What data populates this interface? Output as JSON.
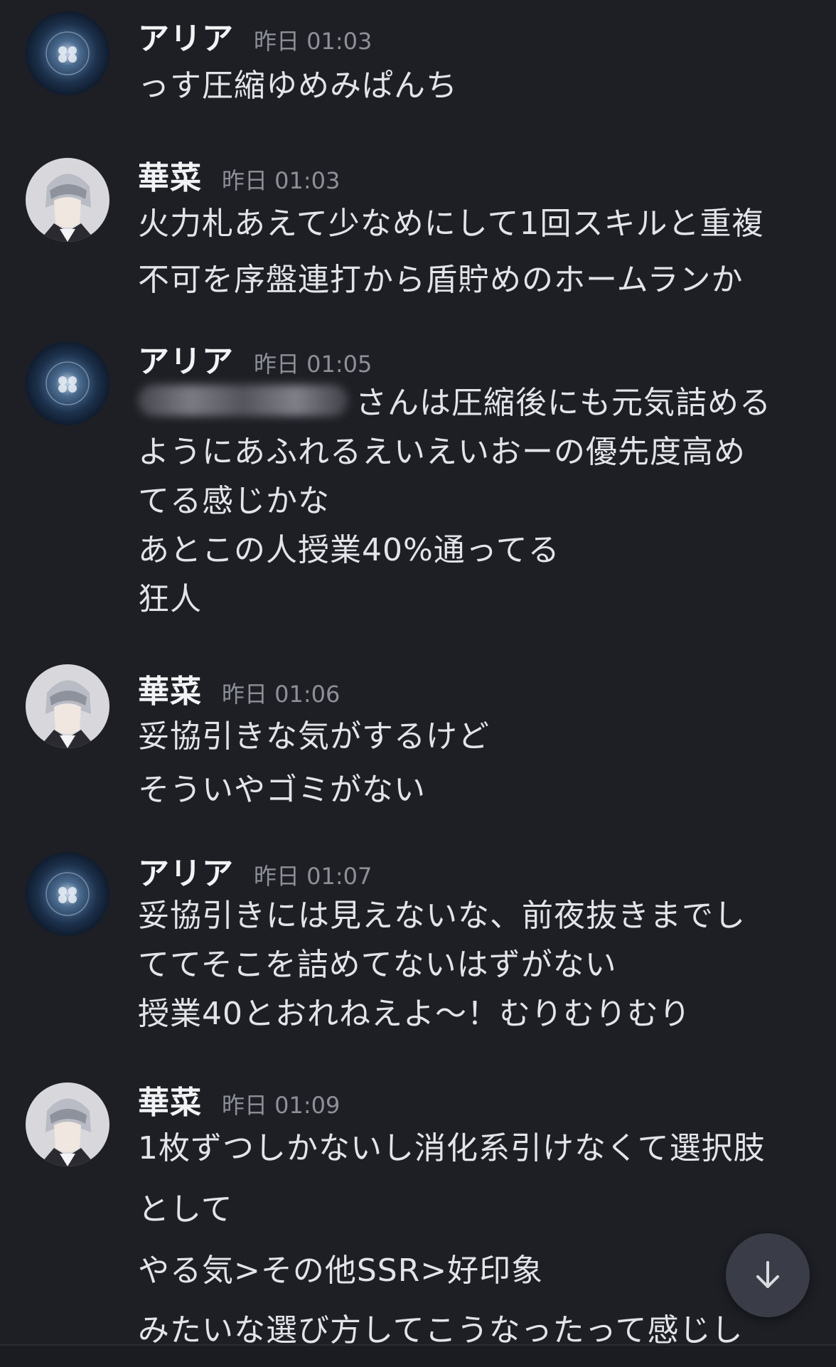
{
  "messages": [
    {
      "author": "アリア",
      "time": "昨日 01:03",
      "avatar": "jellyfish-avatar",
      "lines": [
        "っす圧縮ゆめみぱんち"
      ]
    },
    {
      "author": "華菜",
      "time": "昨日 01:03",
      "avatar": "anime-character-avatar",
      "lines": [
        "火力札あえて少なめにして1回スキルと重複",
        "不可を序盤連打から盾貯めのホームランか"
      ]
    },
    {
      "author": "アリア",
      "time": "昨日 01:05",
      "avatar": "jellyfish-avatar",
      "lines": [
        "さんは圧縮後にも元気詰める",
        "ようにあふれるえいえいおーの優先度高め",
        "てる感じかな",
        "あとこの人授業40%通ってる",
        "狂人"
      ]
    },
    {
      "author": "華菜",
      "time": "昨日 01:06",
      "avatar": "anime-character-avatar",
      "lines": [
        "妥協引きな気がするけど",
        "そういやゴミがない"
      ]
    },
    {
      "author": "アリア",
      "time": "昨日 01:07",
      "avatar": "jellyfish-avatar",
      "lines": [
        "妥協引きには見えないな、前夜抜きまでし",
        "ててそこを詰めてないはずがない",
        "授業40とおれねえよ～！むりむりむり"
      ]
    },
    {
      "author": "華菜",
      "time": "昨日 01:09",
      "avatar": "anime-character-avatar",
      "lines": [
        "1枚ずつしかないし消化系引けなくて選択肢",
        "として",
        "やる気>その他SSR>好印象",
        "みたいな選び方してこうなったって感じし"
      ]
    }
  ],
  "scroll_button": {
    "icon": "arrow-down-icon"
  },
  "colors": {
    "background": "#1e1f25",
    "text": "#e3e4e8",
    "timestamp": "#8e9099",
    "button": "#3a3d47"
  }
}
